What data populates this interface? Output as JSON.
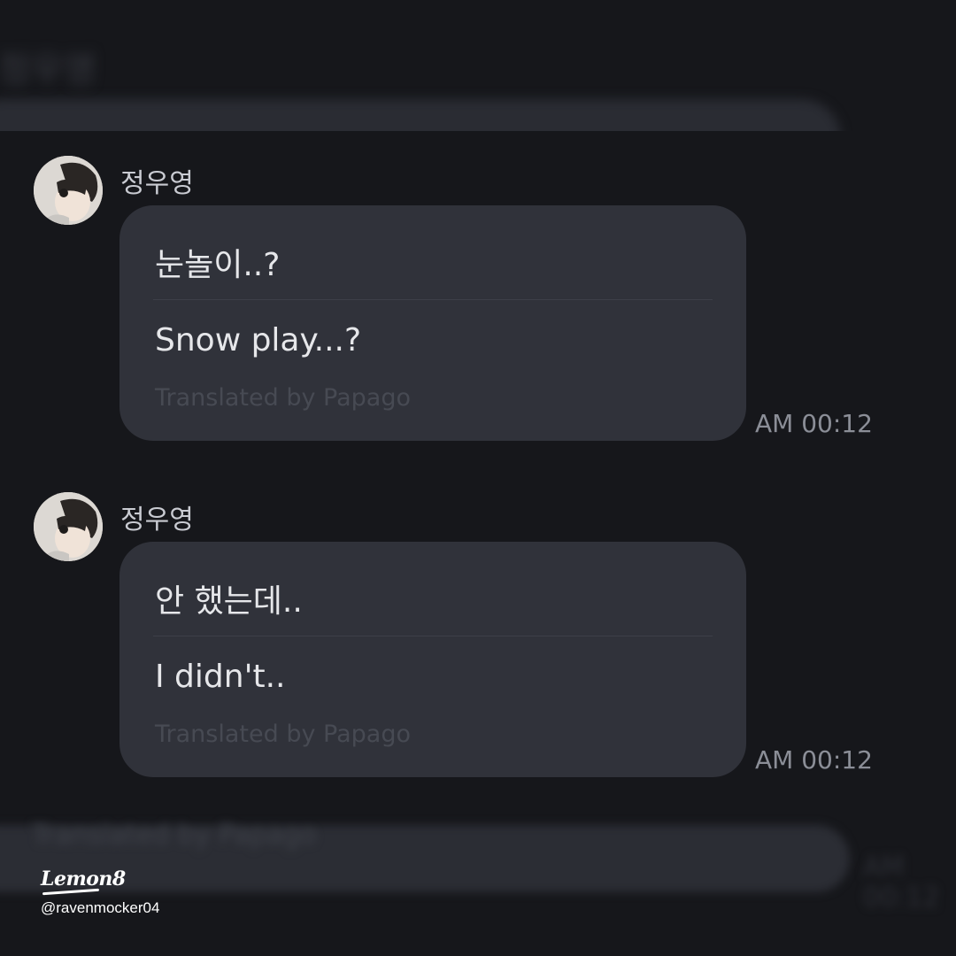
{
  "header": {
    "contact_name": "정우영"
  },
  "messages": [
    {
      "sender": "정우영",
      "original_text": "눈놀이..?",
      "translated_text": "Snow play...?",
      "translation_credit": "Translated by Papago",
      "time": "AM 00:12"
    },
    {
      "sender": "정우영",
      "original_text": "안 했는데..",
      "translated_text": "I didn't..",
      "translation_credit": "Translated by Papago",
      "time": "AM 00:12"
    }
  ],
  "partial_below": {
    "translation_credit": "Translated by Papago",
    "time": "AM 00:12"
  },
  "watermark": {
    "logo": "Lemon8",
    "handle": "@ravenmocker04"
  },
  "colors": {
    "background": "#16171b",
    "bubble": "#30323a",
    "text": "#e6e7ea",
    "muted": "#474a53",
    "time": "#8b8e97"
  }
}
